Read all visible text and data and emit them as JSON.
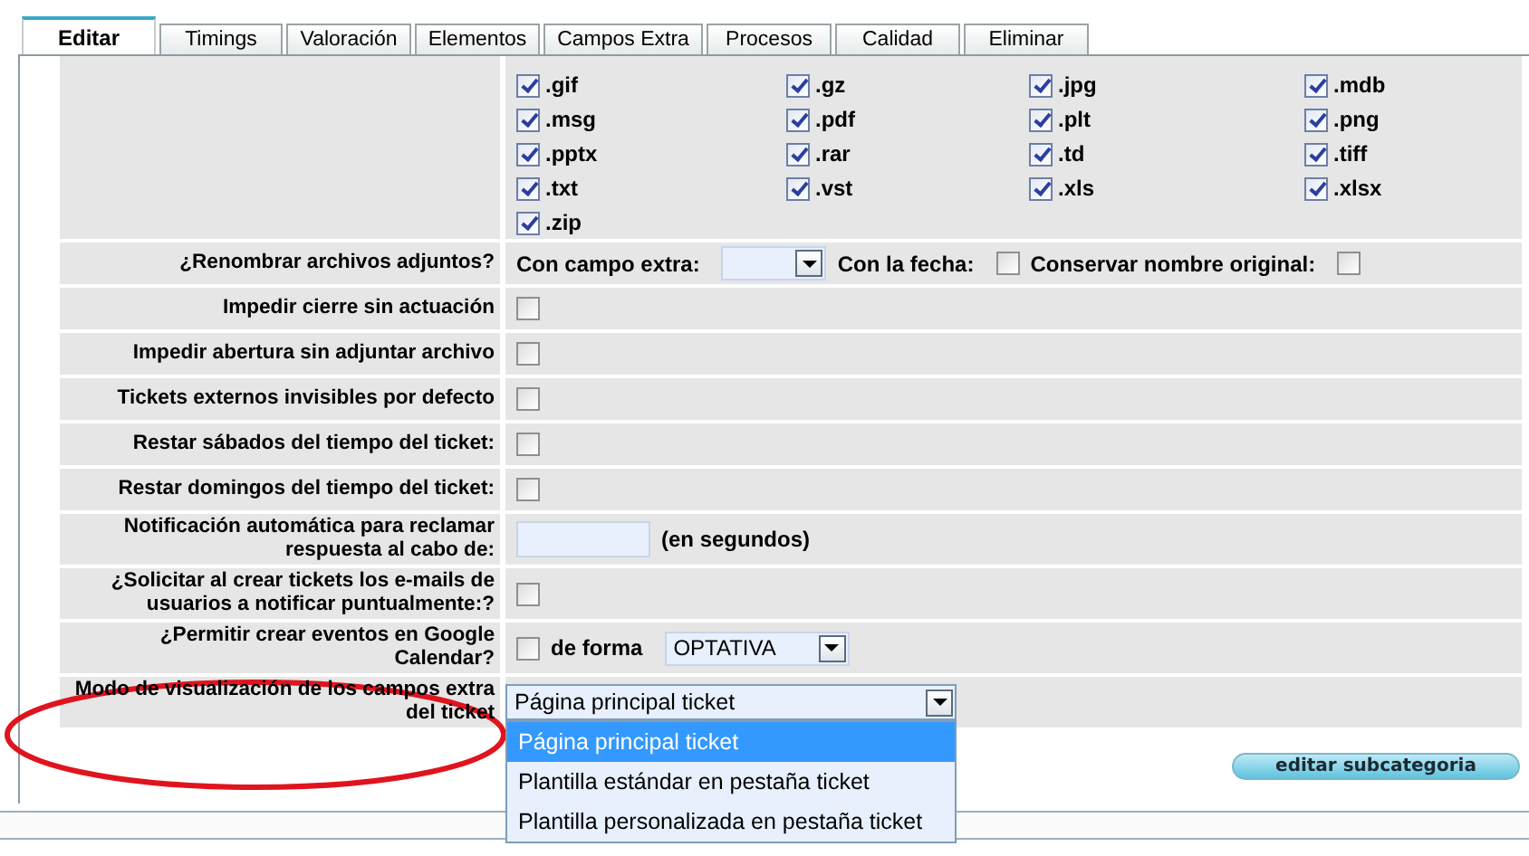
{
  "tabs": [
    {
      "label": "Editar",
      "selected": true
    },
    {
      "label": "Timings",
      "selected": false
    },
    {
      "label": "Valoración",
      "selected": false
    },
    {
      "label": "Elementos",
      "selected": false
    },
    {
      "label": "Campos Extra",
      "selected": false
    },
    {
      "label": "Procesos",
      "selected": false
    },
    {
      "label": "Calidad",
      "selected": false
    },
    {
      "label": "Eliminar",
      "selected": false
    }
  ],
  "extensions": [
    {
      "label": ".gif",
      "checked": true
    },
    {
      "label": ".gz",
      "checked": true
    },
    {
      "label": ".jpg",
      "checked": true
    },
    {
      "label": ".mdb",
      "checked": true
    },
    {
      "label": ".msg",
      "checked": true
    },
    {
      "label": ".pdf",
      "checked": true
    },
    {
      "label": ".plt",
      "checked": true
    },
    {
      "label": ".png",
      "checked": true
    },
    {
      "label": ".pptx",
      "checked": true
    },
    {
      "label": ".rar",
      "checked": true
    },
    {
      "label": ".td",
      "checked": true
    },
    {
      "label": ".tiff",
      "checked": true
    },
    {
      "label": ".txt",
      "checked": true
    },
    {
      "label": ".vst",
      "checked": true
    },
    {
      "label": ".xls",
      "checked": true
    },
    {
      "label": ".xlsx",
      "checked": true
    },
    {
      "label": ".zip",
      "checked": true
    }
  ],
  "settings": [
    {
      "label": "¿Renombrar archivos adjuntos?",
      "controls": [
        {
          "kind": "text",
          "text": "Con campo extra:"
        },
        {
          "kind": "select"
        },
        {
          "kind": "text",
          "text": "Con la fecha:"
        },
        {
          "kind": "checkbox",
          "checked": false
        },
        {
          "kind": "text",
          "text": "Conservar nombre original:"
        },
        {
          "kind": "checkbox",
          "checked": false
        }
      ]
    },
    {
      "label": "Impedir cierre sin actuación",
      "controls": [
        {
          "kind": "checkbox",
          "checked": false
        }
      ]
    },
    {
      "label": "Impedir abertura sin adjuntar archivo",
      "controls": [
        {
          "kind": "checkbox",
          "checked": false
        }
      ]
    },
    {
      "label": "Tickets externos invisibles por defecto",
      "controls": [
        {
          "kind": "checkbox",
          "checked": false
        }
      ]
    },
    {
      "label": "Restar sábados del tiempo del ticket:",
      "controls": [
        {
          "kind": "checkbox",
          "checked": false
        }
      ]
    },
    {
      "label": "Restar domingos del tiempo del ticket:",
      "controls": [
        {
          "kind": "checkbox",
          "checked": false
        }
      ]
    },
    {
      "label": "Notificación automática para reclamar respuesta al cabo de:",
      "controls": [
        {
          "kind": "input"
        },
        {
          "kind": "text",
          "text": "(en segundos)"
        }
      ]
    },
    {
      "label": "¿Solicitar al crear tickets los e-mails de usuarios a notificar puntualmente:?",
      "controls": [
        {
          "kind": "checkbox",
          "checked": false
        }
      ]
    },
    {
      "label": "¿Permitir crear eventos en Google Calendar?",
      "controls": [
        {
          "kind": "checkbox",
          "checked": false
        },
        {
          "kind": "text",
          "text": "de forma"
        },
        {
          "kind": "select",
          "value": "OPTATIVA"
        }
      ]
    },
    {
      "label": "Modo de visualización de los campos extra del ticket",
      "annotated": true,
      "controls": [
        {
          "kind": "dropdown",
          "value": "Página principal ticket",
          "open": true,
          "options": [
            {
              "label": "Página principal ticket",
              "selected": true
            },
            {
              "label": "Plantilla estándar en pestaña ticket",
              "selected": false
            },
            {
              "label": "Plantilla personalizada en pestaña ticket",
              "selected": false
            }
          ]
        }
      ]
    }
  ],
  "button": "editar subcategoria"
}
